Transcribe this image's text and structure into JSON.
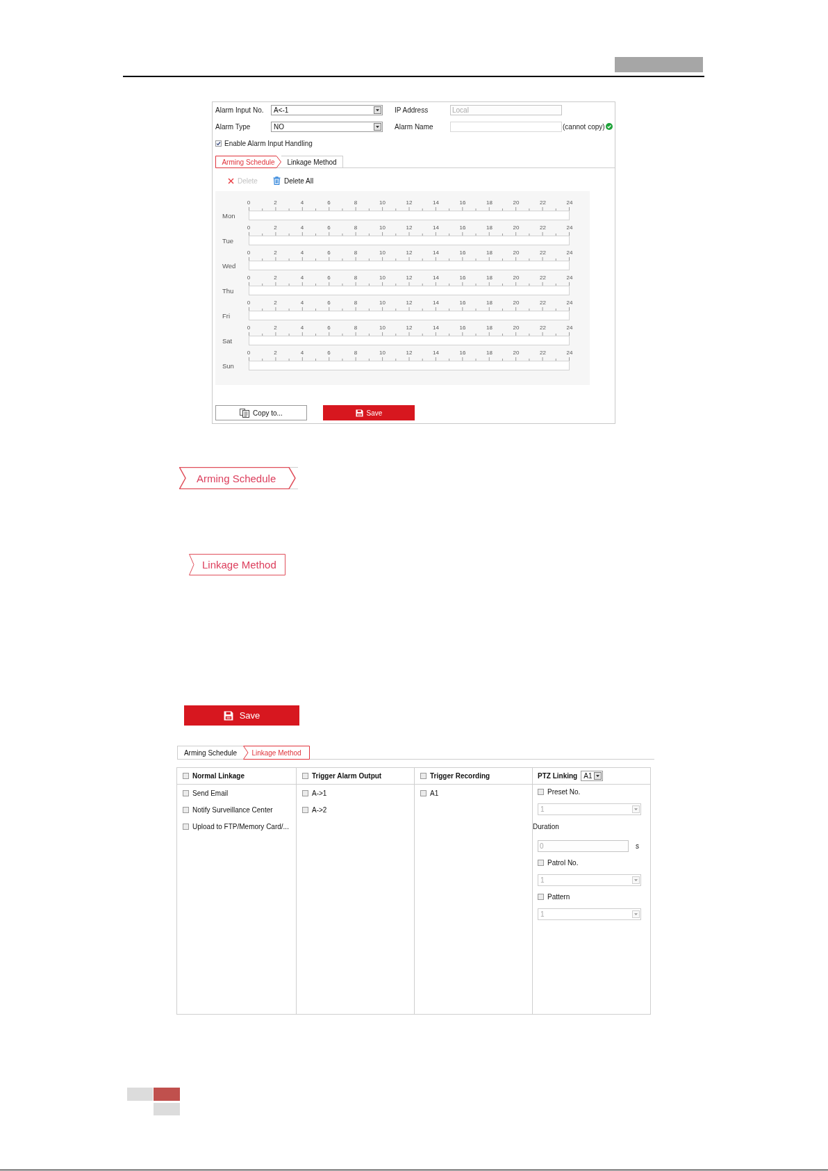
{
  "form": {
    "rows": [
      [
        {
          "label": "Alarm Input No.",
          "kind": "select",
          "value": "A<-1",
          "disabled": false
        },
        {
          "label": "IP Address",
          "kind": "text",
          "value": "Local",
          "disabled": true
        }
      ],
      [
        {
          "label": "Alarm Type",
          "kind": "select",
          "value": "NO",
          "disabled": false
        },
        {
          "label": "Alarm Name",
          "kind": "text",
          "note": "(cannot copy)",
          "valid": true,
          "disabled": false
        }
      ]
    ],
    "enable": {
      "label": "Enable Alarm Input Handling",
      "checked": true
    }
  },
  "schedule_tabs": [
    {
      "label": "Arming Schedule",
      "selected": true
    },
    {
      "label": "Linkage Method",
      "selected": false
    }
  ],
  "toolbar": [
    {
      "kind": "delete",
      "label": "Delete",
      "disabled": true
    },
    {
      "kind": "delete_all",
      "label": "Delete All",
      "disabled": false
    }
  ],
  "schedule": {
    "days": [
      {
        "day": "Mon",
        "hours": [
          "0",
          "2",
          "4",
          "6",
          "8",
          "10",
          "12",
          "14",
          "16",
          "18",
          "20",
          "22",
          "24"
        ]
      },
      {
        "day": "Tue",
        "hours": [
          "0",
          "2",
          "4",
          "6",
          "8",
          "10",
          "12",
          "14",
          "16",
          "18",
          "20",
          "22",
          "24"
        ]
      },
      {
        "day": "Wed",
        "hours": [
          "0",
          "2",
          "4",
          "6",
          "8",
          "10",
          "12",
          "14",
          "16",
          "18",
          "20",
          "22",
          "24"
        ]
      },
      {
        "day": "Thu",
        "hours": [
          "0",
          "2",
          "4",
          "6",
          "8",
          "10",
          "12",
          "14",
          "16",
          "18",
          "20",
          "22",
          "24"
        ]
      },
      {
        "day": "Fri",
        "hours": [
          "0",
          "2",
          "4",
          "6",
          "8",
          "10",
          "12",
          "14",
          "16",
          "18",
          "20",
          "22",
          "24"
        ]
      },
      {
        "day": "Sat",
        "hours": [
          "0",
          "2",
          "4",
          "6",
          "8",
          "10",
          "12",
          "14",
          "16",
          "18",
          "20",
          "22",
          "24"
        ]
      },
      {
        "day": "Sun",
        "hours": [
          "0",
          "2",
          "4",
          "6",
          "8",
          "10",
          "12",
          "14",
          "16",
          "18",
          "20",
          "22",
          "24"
        ]
      }
    ]
  },
  "actions": [
    {
      "kind": "copy",
      "label": "Copy to..."
    },
    {
      "kind": "save",
      "label": "Save"
    }
  ],
  "tab_callouts": [
    {
      "kind": "notch_arrow",
      "label": "Arming Schedule"
    },
    {
      "kind": "notch",
      "label": "Linkage Method"
    }
  ],
  "save_callout": {
    "label": "Save"
  },
  "linkage": {
    "tabs": [
      {
        "label": "Arming Schedule",
        "selected": false
      },
      {
        "label": "Linkage Method",
        "selected": true
      }
    ],
    "columns": [
      {
        "kind": "checkbox",
        "title": "Normal Linkage",
        "checked": false,
        "items": [
          {
            "kind": "checkbox",
            "label": "Send Email",
            "checked": false
          },
          {
            "kind": "checkbox",
            "label": "Notify Surveillance Center",
            "checked": false
          },
          {
            "kind": "checkbox",
            "label": "Upload to FTP/Memory Card/...",
            "checked": false
          }
        ]
      },
      {
        "kind": "checkbox",
        "title": "Trigger Alarm Output",
        "checked": false,
        "items": [
          {
            "kind": "checkbox",
            "label": "A->1",
            "checked": false
          },
          {
            "kind": "checkbox",
            "label": "A->2",
            "checked": false
          }
        ]
      },
      {
        "kind": "checkbox",
        "title": "Trigger Recording",
        "checked": false,
        "items": [
          {
            "kind": "checkbox",
            "label": "A1",
            "checked": false
          }
        ]
      },
      {
        "kind": "select",
        "title": "PTZ Linking",
        "value": "A1",
        "items": [
          {
            "kind": "checkbox",
            "label": "Preset No.",
            "checked": false
          },
          {
            "kind": "select",
            "value": "1",
            "disabled": true
          },
          {
            "kind": "label",
            "label": "Duration"
          },
          {
            "kind": "input",
            "value": "0",
            "unit": "s",
            "disabled": true
          },
          {
            "kind": "checkbox",
            "label": "Patrol No.",
            "checked": false
          },
          {
            "kind": "select",
            "value": "1",
            "disabled": true
          },
          {
            "kind": "checkbox",
            "label": "Pattern",
            "checked": false
          },
          {
            "kind": "select",
            "value": "1",
            "disabled": true
          }
        ]
      }
    ]
  }
}
